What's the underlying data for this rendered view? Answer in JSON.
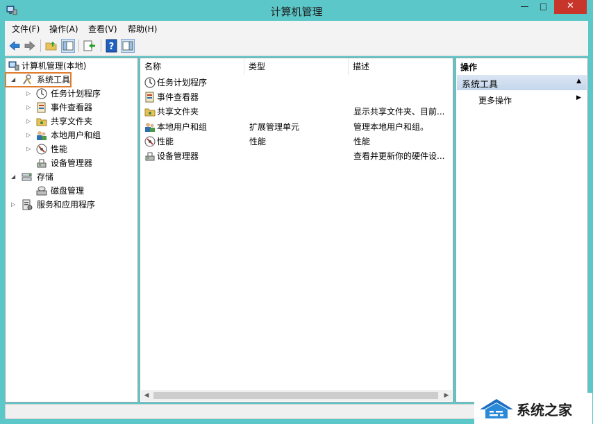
{
  "window": {
    "title": "计算机管理",
    "minimize_label": "—",
    "maximize_label": "□",
    "close_label": "✕"
  },
  "menu": [
    "文件(F)",
    "操作(A)",
    "查看(V)",
    "帮助(H)"
  ],
  "toolbar": {
    "buttons": [
      "back-icon",
      "forward-icon",
      "up-folder-icon",
      "show-hide-tree-icon",
      "export-list-icon",
      "help-icon",
      "show-hide-action-pane-icon"
    ]
  },
  "tree": {
    "root": "计算机管理(本地)",
    "system_tools": "系统工具",
    "task_scheduler": "任务计划程序",
    "event_viewer": "事件查看器",
    "shared_folders": "共享文件夹",
    "local_users": "本地用户和组",
    "performance": "性能",
    "device_manager": "设备管理器",
    "storage": "存储",
    "disk_management": "磁盘管理",
    "services_apps": "服务和应用程序"
  },
  "list": {
    "columns": [
      "名称",
      "类型",
      "描述"
    ],
    "rows": [
      {
        "name": "任务计划程序",
        "type": "",
        "desc": "",
        "icon": "clock-icon"
      },
      {
        "name": "事件查看器",
        "type": "",
        "desc": "",
        "icon": "event-viewer-icon"
      },
      {
        "name": "共享文件夹",
        "type": "",
        "desc": "显示共享文件夹、目前...",
        "icon": "shared-folder-icon"
      },
      {
        "name": "本地用户和组",
        "type": "扩展管理单元",
        "desc": "管理本地用户和组。",
        "icon": "users-icon"
      },
      {
        "name": "性能",
        "type": "性能",
        "desc": "性能",
        "icon": "performance-icon"
      },
      {
        "name": "设备管理器",
        "type": "",
        "desc": "查看并更新你的硬件设...",
        "icon": "device-manager-icon"
      }
    ]
  },
  "actions": {
    "title": "操作",
    "section": "系统工具",
    "more": "更多操作"
  },
  "watermark": {
    "text": "系统之家"
  },
  "colors": {
    "frame": "#5cc7c8",
    "close": "#c7352b",
    "selection_outline": "#e07b2b",
    "action_header": "#c4d6ec"
  }
}
